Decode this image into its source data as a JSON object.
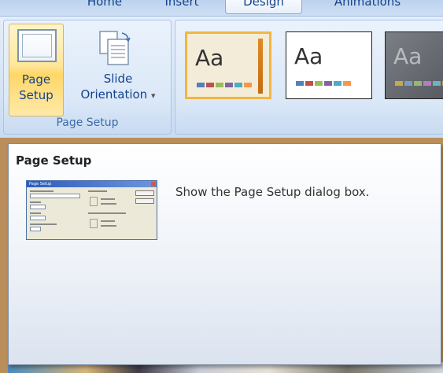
{
  "ribbon": {
    "tabs": [
      {
        "label": "Home"
      },
      {
        "label": "Insert"
      },
      {
        "label": "Design"
      },
      {
        "label": "Animations"
      }
    ],
    "page_setup_group": {
      "title": "Page Setup",
      "page_setup_button": {
        "line1": "Page",
        "line2": "Setup"
      },
      "slide_orientation_button": {
        "line1": "Slide",
        "line2": "Orientation",
        "arrow": "▾"
      }
    },
    "themes": [
      {
        "label": "Aa",
        "swatches": [
          "#4f81bd",
          "#c0504d",
          "#9bbb59",
          "#8064a2",
          "#4bacc6",
          "#f79646"
        ]
      },
      {
        "label": "Aa",
        "swatches": [
          "#4f81bd",
          "#c0504d",
          "#9bbb59",
          "#8064a2",
          "#4bacc6",
          "#f79646"
        ]
      },
      {
        "label": "Aa",
        "swatches": [
          "#c9a74b",
          "#7c9bc2",
          "#9bb56a",
          "#b57dbc",
          "#6fb3c2",
          "#d59a52"
        ]
      }
    ]
  },
  "tooltip": {
    "title": "Page Setup",
    "description": "Show the Page Setup dialog box.",
    "preview_dialog_title": "Page Setup"
  },
  "colors": {
    "ribbon_text": "#15428b",
    "hover_button": "#ffe69a",
    "theme_selected_border": "#f2b640"
  }
}
